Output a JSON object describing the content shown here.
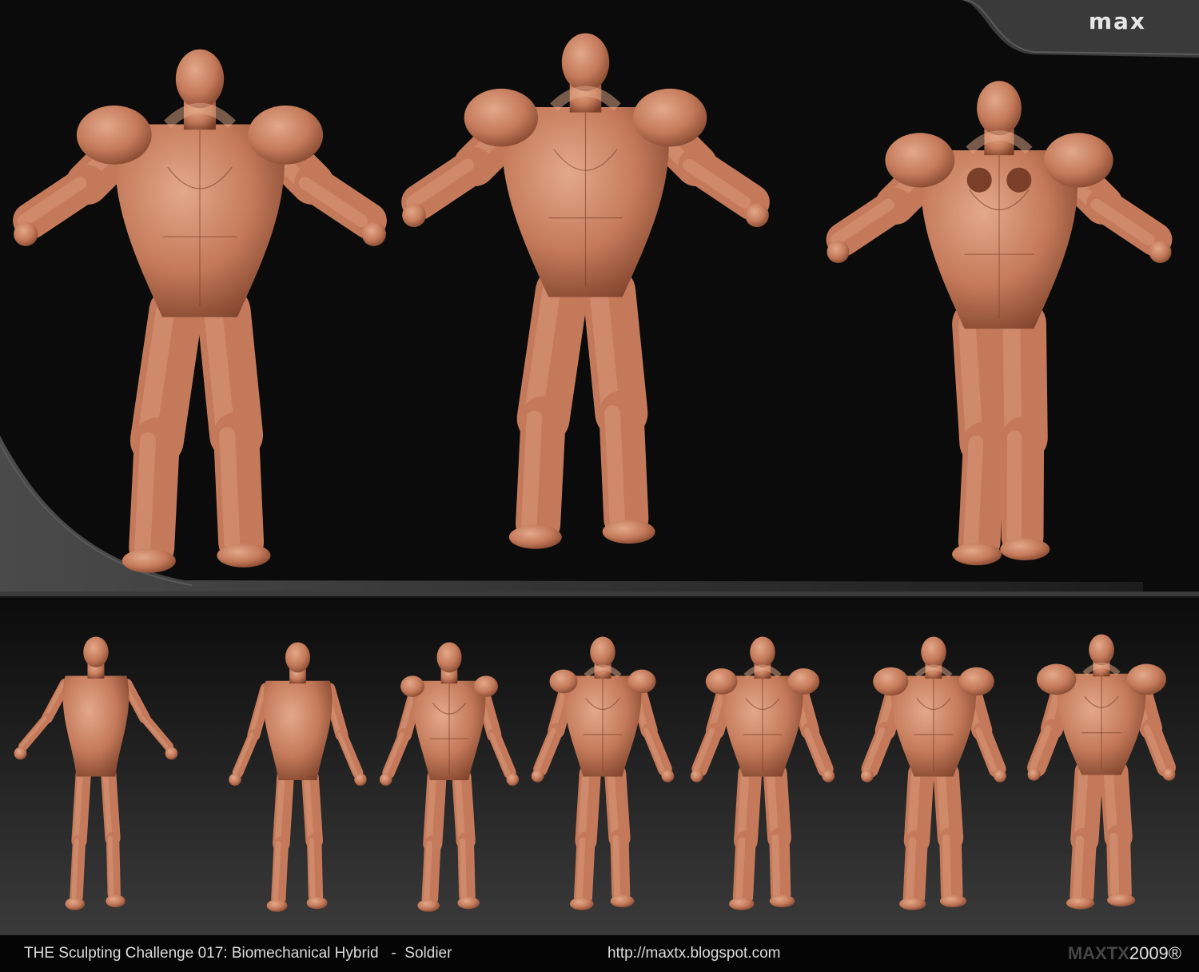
{
  "logo": {
    "text": "max"
  },
  "footer": {
    "title": "THE Sculpting Challenge 017: Biomechanical Hybrid   -  Soldier",
    "url": "http://maxtx.blogspot.com",
    "brand_name": "MAXTX",
    "brand_year": "2009®"
  },
  "colors": {
    "clay": "#c47a5a",
    "clay_dark": "#7a3f28",
    "clay_light": "#e3a98a",
    "background": "#0b0b0b",
    "panel_dark": "#1c1c1c",
    "panel_light": "#3a3a3a",
    "accent_gray": "#4a4a4a"
  },
  "images": {
    "hero_views": [
      "front-three-quarter",
      "front",
      "back"
    ],
    "progression_stage_count": 7
  }
}
